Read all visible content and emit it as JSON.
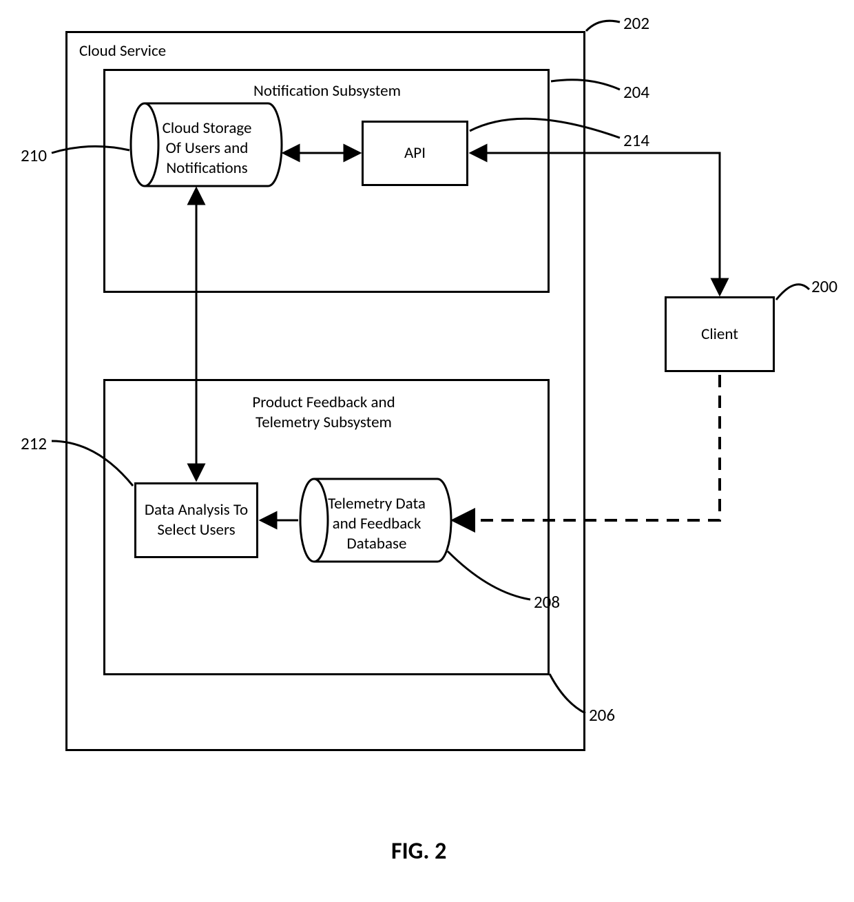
{
  "figure_caption": "FIG. 2",
  "refs": {
    "r200": "200",
    "r202": "202",
    "r204": "204",
    "r206": "206",
    "r208": "208",
    "r210": "210",
    "r212": "212",
    "r214": "214"
  },
  "labels": {
    "cloud_service": "Cloud Service",
    "notification_subsystem": "Notification Subsystem",
    "cloud_storage": "Cloud Storage\nOf Users and\nNotifications",
    "api": "API",
    "product_feedback_subsystem": "Product Feedback and\nTelemetry Subsystem",
    "data_analysis": "Data Analysis\nTo Select Users",
    "telemetry_db": "Telemetry Data\nand Feedback\nDatabase",
    "client": "Client"
  }
}
